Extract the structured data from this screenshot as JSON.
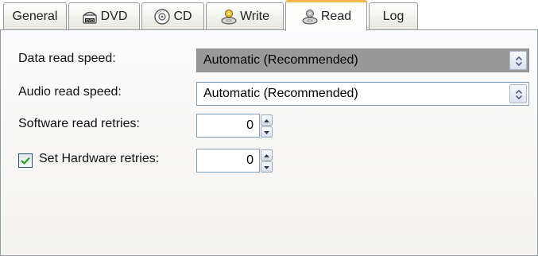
{
  "tabs": [
    {
      "label": "General",
      "icon": "none",
      "active": false
    },
    {
      "label": "DVD",
      "icon": "dvd-drive-icon",
      "active": false
    },
    {
      "label": "CD",
      "icon": "cd-icon",
      "active": false
    },
    {
      "label": "Write",
      "icon": "write-disc-icon",
      "active": false
    },
    {
      "label": "Read",
      "icon": "read-disc-icon",
      "active": true
    },
    {
      "label": "Log",
      "icon": "none",
      "active": false
    }
  ],
  "dvd_badge": "DVD",
  "settings": {
    "data_read_speed": {
      "label": "Data read speed:",
      "value": "Automatic (Recommended)"
    },
    "audio_read_speed": {
      "label": "Audio read speed:",
      "value": "Automatic (Recommended)"
    },
    "software_read_retries": {
      "label": "Software read retries:",
      "value": "0"
    },
    "hardware_retries": {
      "label": "Set Hardware retries:",
      "value": "0",
      "checked": true
    }
  },
  "colors": {
    "active_tab_accent": "#f4b84a",
    "selected_combo_bg": "#999999",
    "field_border": "#7f9db9",
    "checkmark": "#21a121"
  }
}
